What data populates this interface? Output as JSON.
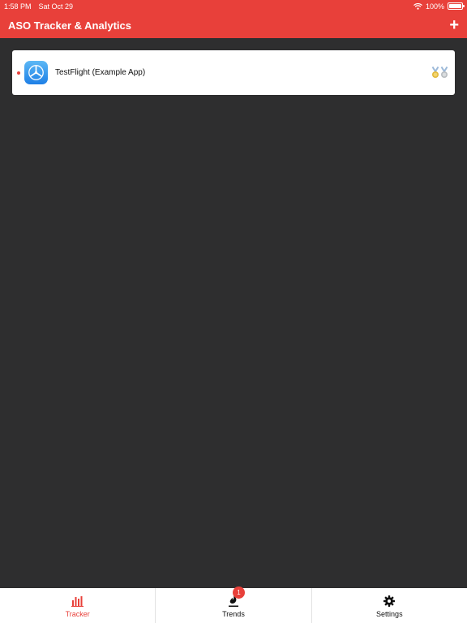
{
  "status_bar": {
    "time": "1:58 PM",
    "date": "Sat Oct 29",
    "battery": "100%"
  },
  "header": {
    "title": "ASO Tracker & Analytics",
    "add_label": "+"
  },
  "apps": [
    {
      "name": "TestFlight (Example App)",
      "icon": "testflight-propeller-icon"
    }
  ],
  "tabs": [
    {
      "label": "Tracker",
      "icon": "bar-chart-icon",
      "active": true
    },
    {
      "label": "Trends",
      "icon": "trends-icon",
      "badge": "1"
    },
    {
      "label": "Settings",
      "icon": "gear-icon"
    }
  ],
  "colors": {
    "accent": "#e8403a",
    "background": "#2e2e2f"
  }
}
